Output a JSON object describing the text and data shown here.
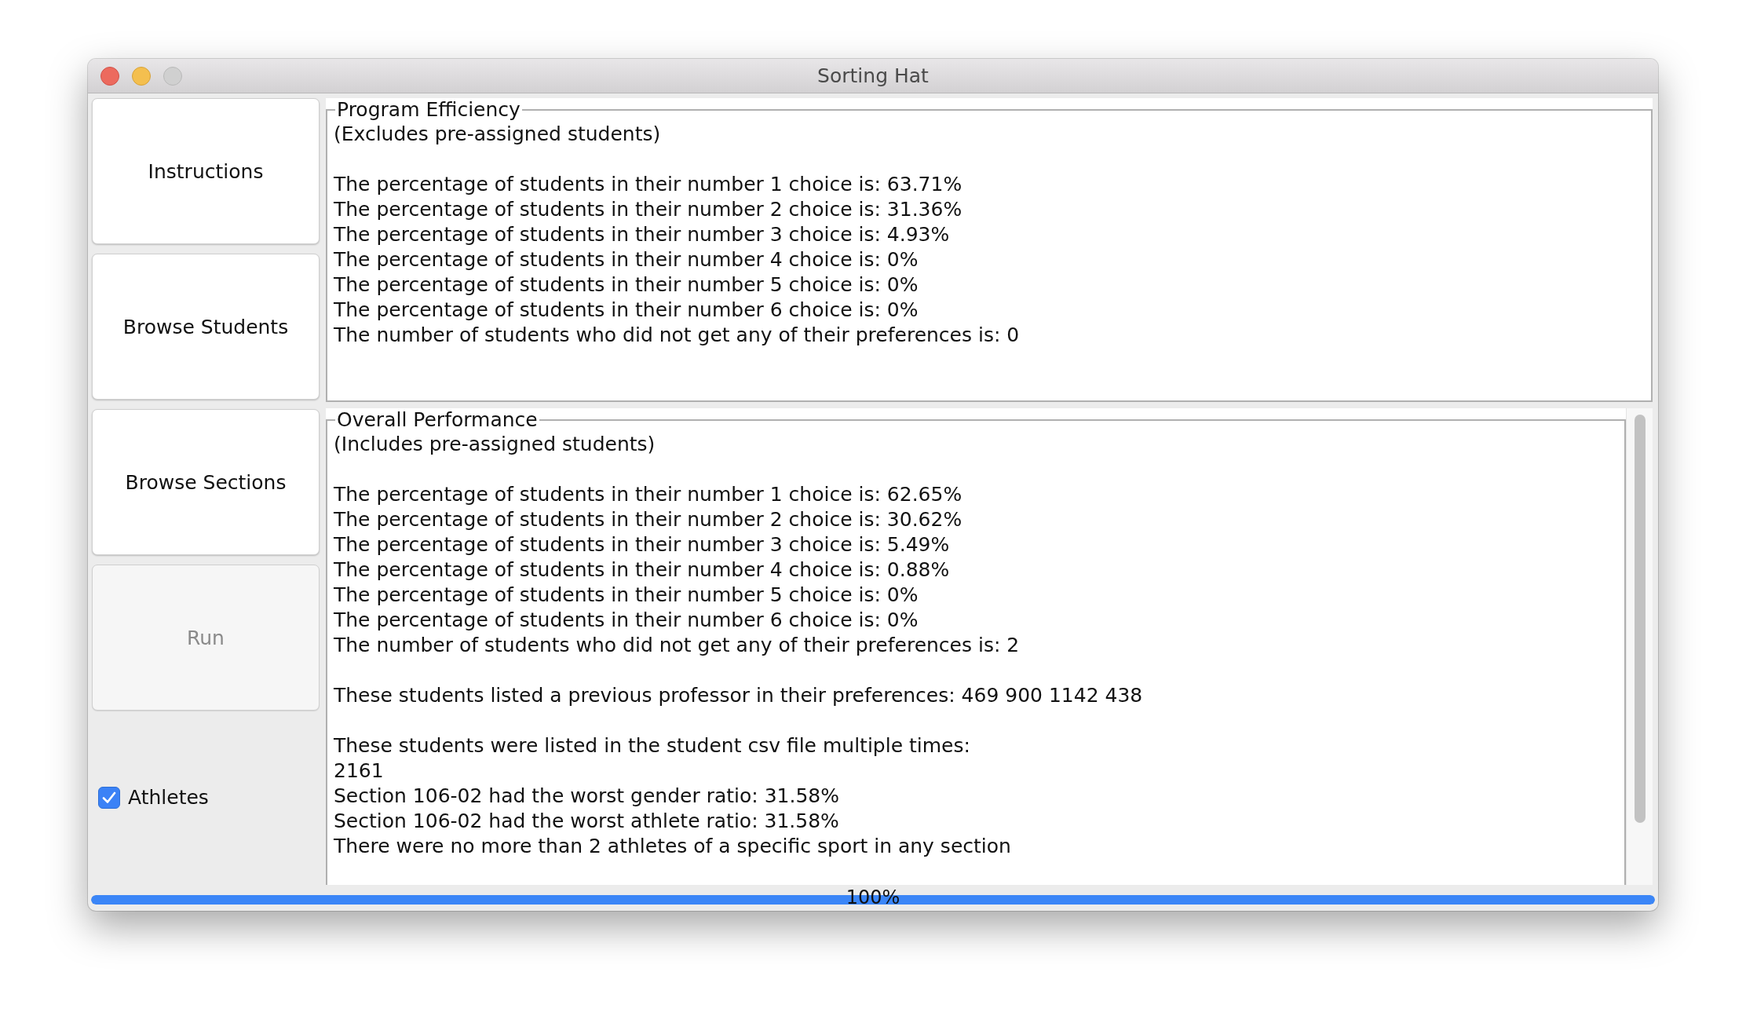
{
  "window": {
    "title": "Sorting Hat"
  },
  "buttons": [
    {
      "label": "Instructions",
      "disabled": false
    },
    {
      "label": "Browse Students",
      "disabled": false
    },
    {
      "label": "Browse Sections",
      "disabled": false
    },
    {
      "label": "Run",
      "disabled": true
    }
  ],
  "athletes_checkbox": {
    "label": "Athletes",
    "checked": true
  },
  "panels": [
    {
      "title": "Program Efficiency",
      "scrollable": false,
      "paragraphs": [
        [
          "(Excludes pre-assigned students)"
        ],
        [
          "The percentage of students in their number 1 choice is: 63.71%",
          "The percentage of students in their number 2 choice is: 31.36%",
          "The percentage of students in their number 3 choice is: 4.93%",
          "The percentage of students in their number 4 choice is: 0%",
          "The percentage of students in their number 5 choice is: 0%",
          "The percentage of students in their number 6 choice is: 0%",
          "The number of students who did not get any of their preferences is: 0"
        ]
      ]
    },
    {
      "title": "Overall Performance",
      "scrollable": true,
      "paragraphs": [
        [
          "(Includes pre-assigned students)"
        ],
        [
          "The percentage of students in their number 1 choice is: 62.65%",
          "The percentage of students in their number 2 choice is: 30.62%",
          "The percentage of students in their number 3 choice is: 5.49%",
          "The percentage of students in their number 4 choice is: 0.88%",
          "The percentage of students in their number 5 choice is: 0%",
          "The percentage of students in their number 6 choice is: 0%",
          "The number of students who did not get any of their preferences is: 2"
        ],
        [
          "These students listed a previous professor in their preferences: 469 900 1142 438"
        ],
        [
          "These students were listed in the student csv file multiple times:",
          "2161",
          "Section 106-02 had the worst gender ratio: 31.58%",
          "Section 106-02 had the worst athlete ratio: 31.58%",
          "There were no more than 2 athletes of a specific sport in any section"
        ]
      ]
    }
  ],
  "progress": {
    "level": 1.0,
    "label": "100%"
  }
}
